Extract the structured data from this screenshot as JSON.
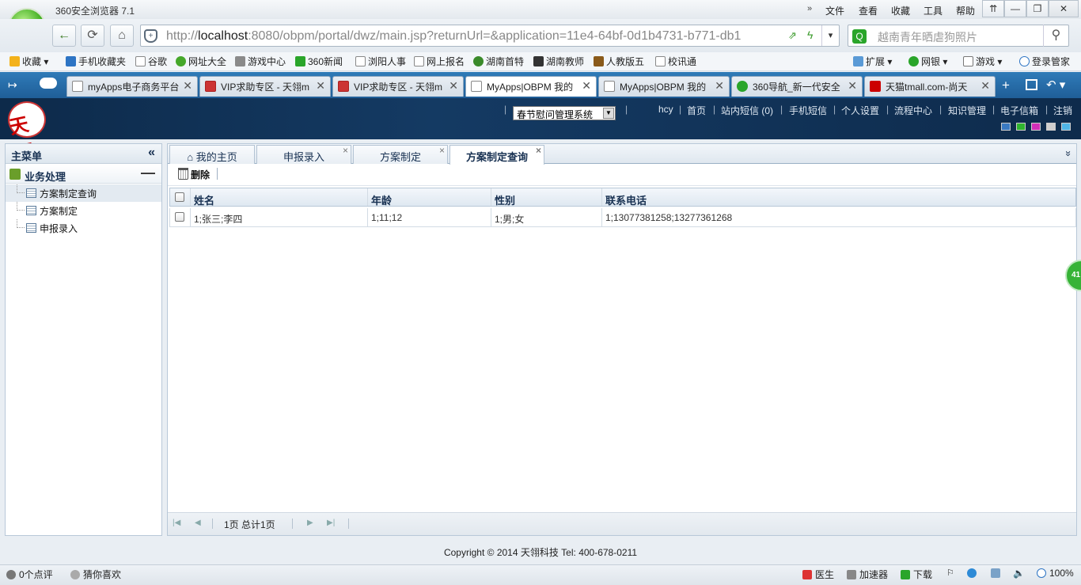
{
  "browser": {
    "title": "360安全浏览器 7.1",
    "menus": [
      "文件",
      "查看",
      "收藏",
      "工具",
      "帮助"
    ],
    "window_buttons": [
      "⇈",
      "—",
      "❐",
      "✕"
    ],
    "logo_letter": "e",
    "url_host": "localhost",
    "url_prefix": "http://",
    "url_rest": ":8080/obpm/portal/dwz/main.jsp?returnUrl=&application=11e4-64bf-0d1b4731-b771-db1",
    "search_text": "越南青年晒虐狗照片",
    "bookmarks": [
      "收藏",
      "手机收藏夹",
      "谷歌",
      "网址大全",
      "游戏中心",
      "360新闻",
      "浏阳人事",
      "网上报名",
      "湖南首特",
      "湖南教师",
      "人教版五",
      "校讯通",
      "扩展",
      "网银",
      "游戏",
      "登录管家"
    ],
    "tabs": [
      {
        "label": "myApps电子商务平台"
      },
      {
        "label": "VIP求助专区 - 天翎m"
      },
      {
        "label": "VIP求助专区 - 天翎m"
      },
      {
        "label": "MyApps|OBPM 我的"
      },
      {
        "label": "MyApps|OBPM 我的"
      },
      {
        "label": "360导航_新一代安全"
      },
      {
        "label": "天猫tmall.com-尚天"
      }
    ],
    "colors": {
      "tabbar": "#2f7bb8",
      "accent_green": "#3fae1e"
    }
  },
  "app": {
    "logo_text": "天翎",
    "system_select": "春节慰问管理系统",
    "user": "hcy",
    "topnav": [
      "首页",
      "站内短信 (0)",
      "手机短信",
      "个人设置",
      "流程中心",
      "知识管理",
      "电子信箱",
      "注销"
    ],
    "theme_colors": [
      "#3a7ac2",
      "#2fb52f",
      "#d22fb8",
      "#cfcfcf",
      "#4fb6e8"
    ],
    "header_color": "#143a63"
  },
  "sidebar": {
    "title": "主菜单",
    "collapse": "«",
    "group": "业务处理",
    "group_toggle": "—",
    "items": [
      "方案制定查询",
      "方案制定",
      "申报录入"
    ]
  },
  "main": {
    "tabs": [
      "我的主页",
      "申报录入",
      "方案制定",
      "方案制定查询"
    ],
    "tab_close": "×",
    "home_icon": "⌂",
    "more": "»",
    "delete_label": "删除",
    "columns": [
      "姓名",
      "年龄",
      "性别",
      "联系电话"
    ],
    "rows": [
      [
        "1;张三;李四",
        "1;11;12",
        "1;男;女",
        "1;13077381258;13277361268"
      ]
    ],
    "pager_text": "1页 总计1页"
  },
  "footer": {
    "copyright": "Copyright © 2014 天翎科技 Tel: 400-678-0211"
  },
  "status": {
    "left": [
      "0个点评",
      "猜你喜欢"
    ],
    "right": [
      "医生",
      "加速器",
      "下载",
      "100%"
    ],
    "badge": "41"
  }
}
